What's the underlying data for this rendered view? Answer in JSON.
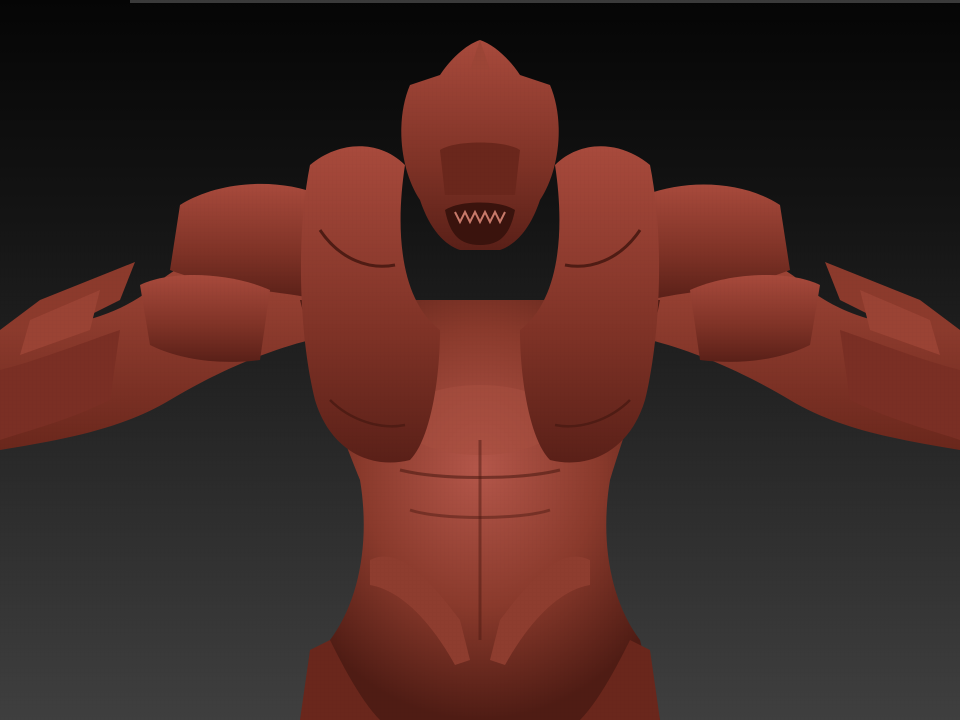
{
  "scene": {
    "subject": "sculpted-armored-creature",
    "colors": {
      "background_top": "#050505",
      "background_bottom": "#3f3f3f",
      "clay_base": "#8a3a2c",
      "clay_light": "#b4574a",
      "clay_dark": "#4f1c14",
      "clay_shadow": "#3a130d"
    }
  }
}
